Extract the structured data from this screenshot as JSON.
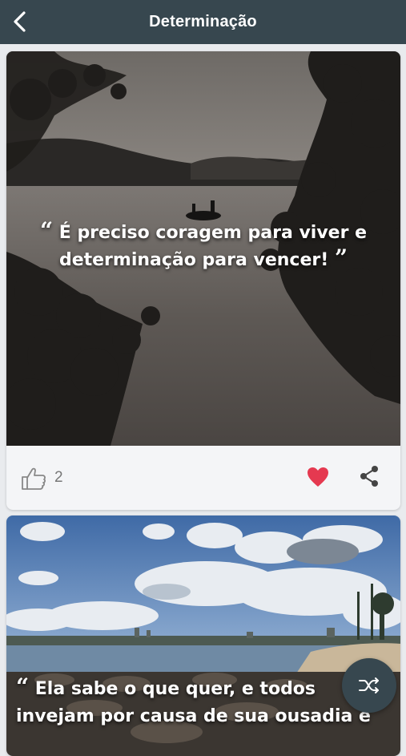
{
  "header": {
    "title": "Determinação",
    "back_icon": "chevron-left-icon"
  },
  "posts": [
    {
      "quote_open": "“",
      "quote_text": "É preciso coragem para viver e determinação para vencer!",
      "quote_close": "”",
      "likes": "2",
      "favorite": true,
      "colors": {
        "heart": "#e53950"
      }
    },
    {
      "quote_open": "“",
      "quote_text": "Ela sabe o que quer, e todos invejam por causa de sua ousadia e"
    }
  ],
  "fab": {
    "icon": "shuffle-icon"
  },
  "colors": {
    "navbar": "#37474f",
    "background": "#e9ebee"
  }
}
